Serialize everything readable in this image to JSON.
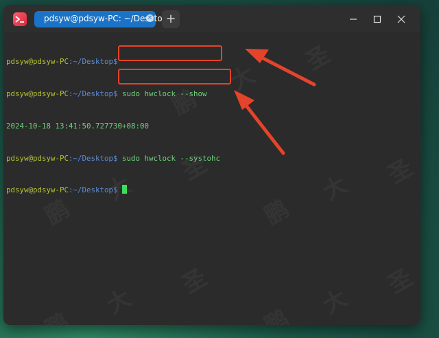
{
  "window": {
    "tab_title": "pdsyw@pdsyw-PC: ~/Desktop",
    "new_tab_label": "+",
    "tab_close_label": "×"
  },
  "terminal": {
    "lines": [
      {
        "user": "pdsyw@pdsyw-PC",
        "path": ":~/Desktop$",
        "text": ""
      },
      {
        "user": "pdsyw@pdsyw-PC",
        "path": ":~/Desktop$",
        "text": " sudo hwclock --show"
      },
      {
        "output": "2024-10-18 13:41:50.727730+08:00"
      },
      {
        "user": "pdsyw@pdsyw-PC",
        "path": ":~/Desktop$",
        "text": " sudo hwclock --systohc"
      },
      {
        "user": "pdsyw@pdsyw-PC",
        "path": ":~/Desktop$",
        "text": " "
      }
    ]
  },
  "watermark": [
    "鹏",
    "大",
    "圣"
  ],
  "colors": {
    "user": "#b6c334",
    "path": "#5b8cd9",
    "command": "#6fd27a",
    "tab_active": "#1a73c6",
    "annotation": "#e5432a",
    "cursor": "#3ddc5a"
  },
  "icons": {
    "app": "terminal-icon",
    "minimize": "minimize-icon",
    "maximize": "maximize-icon",
    "close": "close-icon"
  }
}
